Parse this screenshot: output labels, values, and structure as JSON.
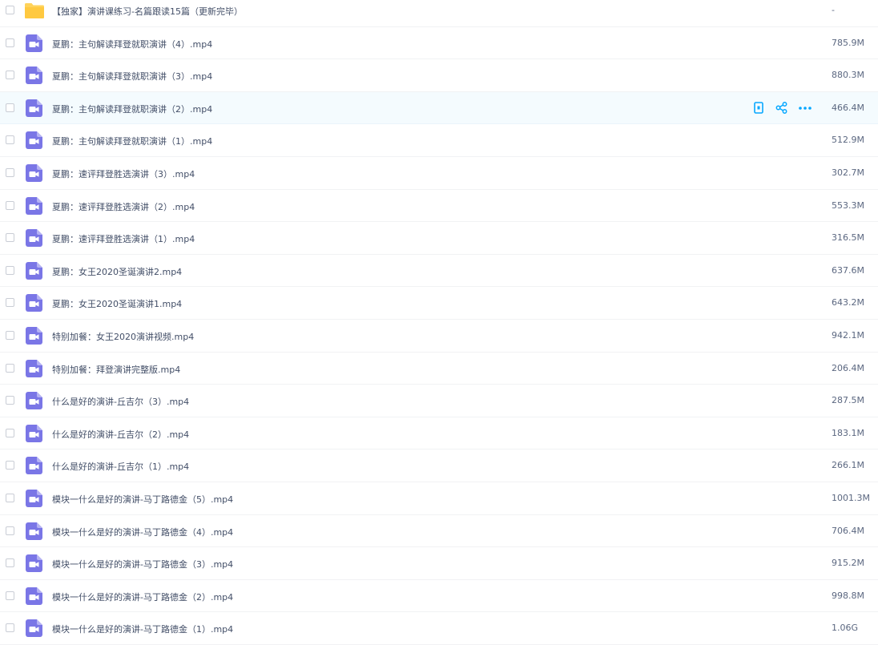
{
  "files": [
    {
      "name": "【独家】演讲课练习-名篇跟读15篇（更新完毕）",
      "size": "-",
      "type": "folder"
    },
    {
      "name": "夏鹏：主句解读拜登就职演讲（4）.mp4",
      "size": "785.9M",
      "type": "video"
    },
    {
      "name": "夏鹏：主句解读拜登就职演讲（3）.mp4",
      "size": "880.3M",
      "type": "video"
    },
    {
      "name": "夏鹏：主句解读拜登就职演讲（2）.mp4",
      "size": "466.4M",
      "type": "video",
      "hovered": true
    },
    {
      "name": "夏鹏：主句解读拜登就职演讲（1）.mp4",
      "size": "512.9M",
      "type": "video"
    },
    {
      "name": "夏鹏：速评拜登胜选演讲（3）.mp4",
      "size": "302.7M",
      "type": "video"
    },
    {
      "name": "夏鹏：速评拜登胜选演讲（2）.mp4",
      "size": "553.3M",
      "type": "video"
    },
    {
      "name": "夏鹏：速评拜登胜选演讲（1）.mp4",
      "size": "316.5M",
      "type": "video"
    },
    {
      "name": "夏鹏：女王2020圣诞演讲2.mp4",
      "size": "637.6M",
      "type": "video"
    },
    {
      "name": "夏鹏：女王2020圣诞演讲1.mp4",
      "size": "643.2M",
      "type": "video"
    },
    {
      "name": "特别加餐：女王2020演讲视频.mp4",
      "size": "942.1M",
      "type": "video"
    },
    {
      "name": "特别加餐：拜登演讲完整版.mp4",
      "size": "206.4M",
      "type": "video"
    },
    {
      "name": "什么是好的演讲-丘吉尔（3）.mp4",
      "size": "287.5M",
      "type": "video"
    },
    {
      "name": "什么是好的演讲-丘吉尔（2）.mp4",
      "size": "183.1M",
      "type": "video"
    },
    {
      "name": "什么是好的演讲-丘吉尔（1）.mp4",
      "size": "266.1M",
      "type": "video"
    },
    {
      "name": "模块一什么是好的演讲-马丁路德金（5）.mp4",
      "size": "1001.3M",
      "type": "video"
    },
    {
      "name": "模块一什么是好的演讲-马丁路德金（4）.mp4",
      "size": "706.4M",
      "type": "video"
    },
    {
      "name": "模块一什么是好的演讲-马丁路德金（3）.mp4",
      "size": "915.2M",
      "type": "video"
    },
    {
      "name": "模块一什么是好的演讲-马丁路德金（2）.mp4",
      "size": "998.8M",
      "type": "video"
    },
    {
      "name": "模块一什么是好的演讲-马丁路德金（1）.mp4",
      "size": "1.06G",
      "type": "video"
    }
  ],
  "row_actions": [
    "phone-icon",
    "share-icon",
    "more-icon"
  ],
  "colors": {
    "video_icon": "#7a76e6",
    "folder_icon": "#ffd35a",
    "action_icon": "#06a7ff",
    "hover_bg": "#f4fbfe"
  }
}
